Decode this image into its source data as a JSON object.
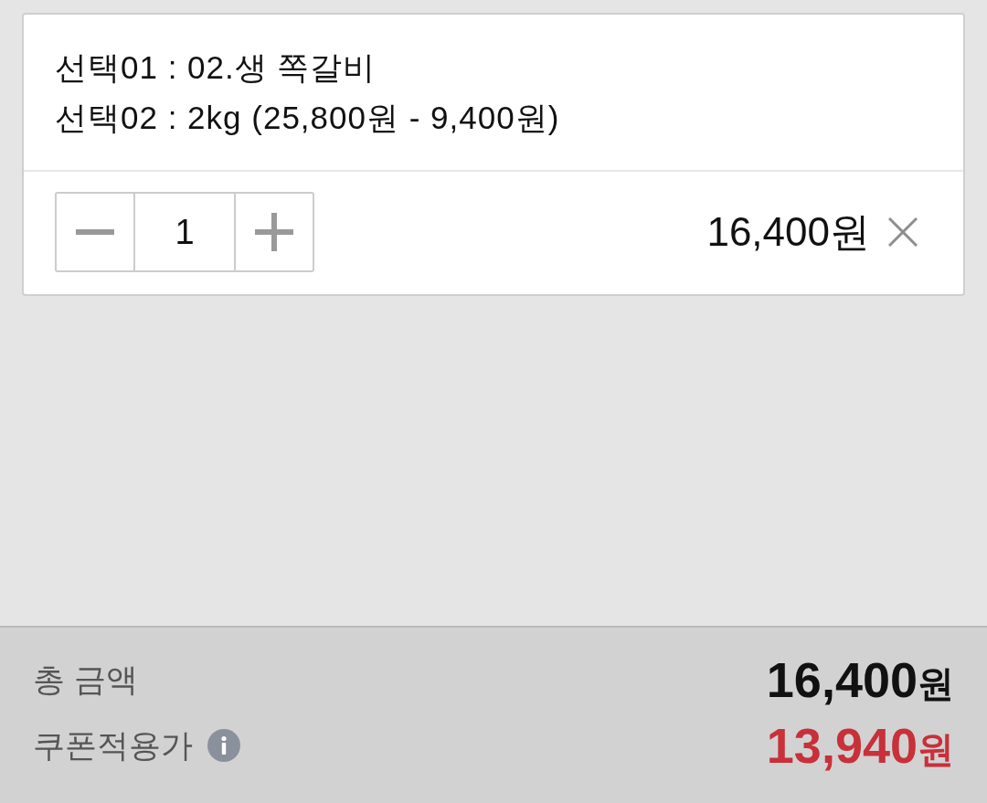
{
  "item": {
    "options": [
      "선택01 : 02.생 쪽갈비",
      "선택02 : 2kg (25,800원 - 9,400원)"
    ],
    "quantity": {
      "value": "1"
    },
    "price": "16,400원"
  },
  "summary": [
    {
      "kind": "total",
      "label": "총 금액",
      "amount": "16,400",
      "unit": "원",
      "info": false
    },
    {
      "kind": "coupon",
      "label": "쿠폰적용가",
      "amount": "13,940",
      "unit": "원",
      "info": true
    }
  ]
}
